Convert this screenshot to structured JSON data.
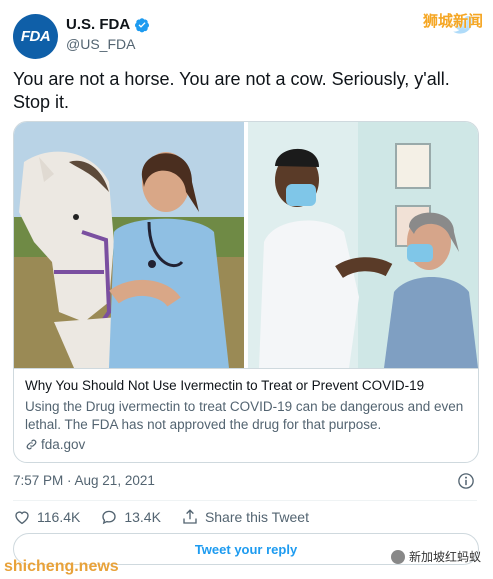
{
  "account": {
    "avatar_text": "FDA",
    "name": "U.S. FDA",
    "handle": "@US_FDA",
    "brand_color": "#0f5fa8"
  },
  "overlay": {
    "top_watermark": "狮城新闻",
    "bottom_left_watermark": "shicheng.news",
    "bottom_right_watermark": "新加坡红蚂蚁"
  },
  "tweet": {
    "text": "You are not a horse. You are not a cow. Seriously, y'all. Stop it.",
    "timestamp": "7:57 PM · Aug 21, 2021"
  },
  "card": {
    "title": "Why You Should Not Use Ivermectin to Treat or Prevent COVID-19",
    "description": "Using the Drug ivermectin to treat COVID-19 can be dangerous and even lethal. The FDA has not approved the drug for that purpose.",
    "domain": "fda.gov"
  },
  "actions": {
    "likes": "116.4K",
    "replies": "13.4K",
    "share_label": "Share this Tweet"
  },
  "reply_button": {
    "label": "Tweet your reply"
  },
  "icons": {
    "verified": "verified-badge-icon",
    "info": "info-icon",
    "like": "heart-icon",
    "reply": "speech-bubble-icon",
    "share": "share-icon",
    "link": "link-icon",
    "accent": "#1d9bf0"
  }
}
